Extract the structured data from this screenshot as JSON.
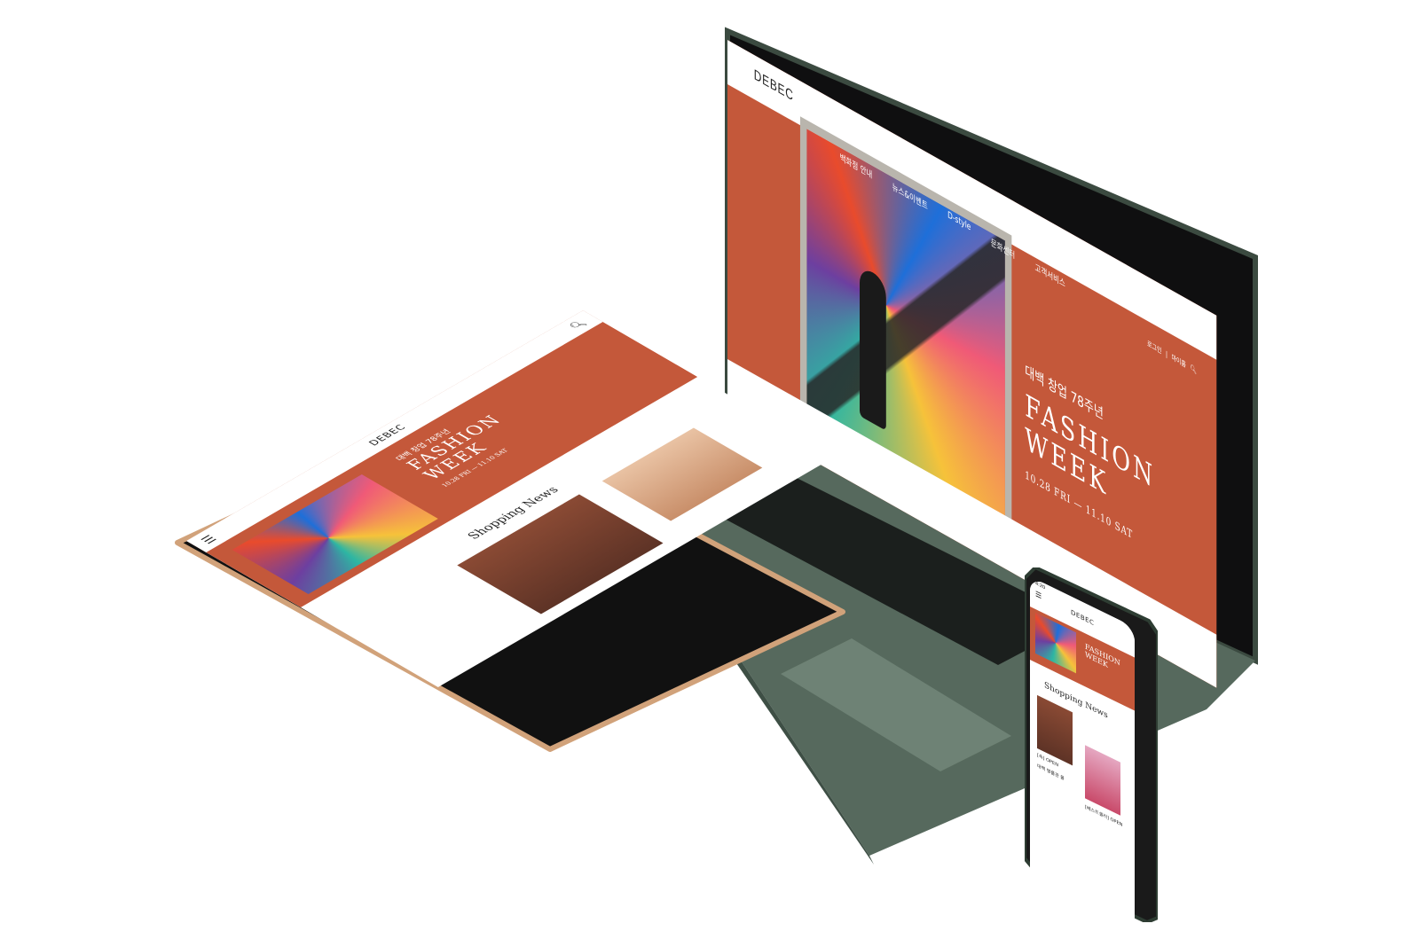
{
  "laptop": {
    "logo": "DEBEC",
    "nav": [
      "백화점 안내",
      "뉴스&이벤트",
      "D-style",
      "문화센터",
      "고객서비스"
    ],
    "utility": [
      "로그인",
      "|",
      "마이홈"
    ],
    "hero": {
      "kr_title": "대백 창업 78주년",
      "title_line1": "FASHION",
      "title_line2": "WEEK",
      "date": "10.28 FRI  —  11.10 SAT"
    }
  },
  "tablet": {
    "logo": "DEBEC",
    "hero": {
      "kr_title": "대백 창업 78주년",
      "title_line1": "FASHION",
      "title_line2": "WEEK",
      "date": "10.28 FRI  —  11.10 SAT"
    },
    "section_title": "Shopping News"
  },
  "phone": {
    "time": "4:20",
    "logo": "DEBEC",
    "hero": {
      "title_line1": "FASHION",
      "title_line2": "WEEK"
    },
    "section_title": "Shopping News",
    "items": [
      "[속] OPEN",
      "대백 명품관 몰",
      "[베스트셀러] OPEN"
    ]
  },
  "colors": {
    "brand": "#c4583a",
    "laptop_body": "#5f7366",
    "tablet_frame": "#d1a27a",
    "phone_frame": "#2e3d33"
  }
}
